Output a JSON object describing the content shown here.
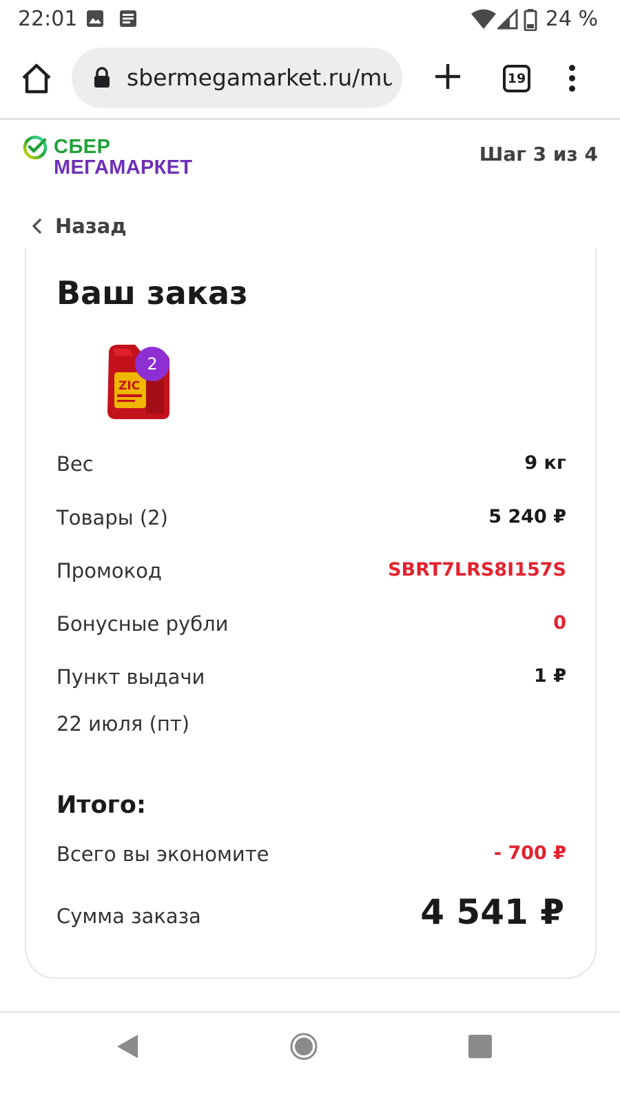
{
  "status_bar": {
    "time": "22:01",
    "battery_percent": "24 %",
    "icons": [
      "image-icon",
      "news-icon",
      "wifi-icon",
      "signal-icon",
      "battery-icon"
    ]
  },
  "browser": {
    "url": "sbermegamarket.ru/multi",
    "tab_count": "19"
  },
  "header": {
    "logo_line1": "СБЕР",
    "logo_line2": "МЕГАМАРКЕТ",
    "step": "Шаг 3 из 4"
  },
  "back_label": "Назад",
  "order": {
    "title": "Ваш заказ",
    "item_quantity": "2",
    "rows": [
      {
        "label": "Вес",
        "value": "9 кг"
      },
      {
        "label": "Товары (2)",
        "value": "5 240 ₽"
      },
      {
        "label": "Промокод",
        "value": "SBRT7LRS8I157S"
      },
      {
        "label": "Бонусные рубли",
        "value": "0"
      },
      {
        "label": "Пункт выдачи",
        "value": "1 ₽"
      }
    ],
    "delivery_date": "22 июля (пт)",
    "total_title": "Итого:",
    "savings_label": "Всего вы экономите",
    "savings_value": "- 700 ₽",
    "sum_label": "Сумма заказа",
    "sum_value": "4 541 ₽"
  },
  "colors": {
    "accent_red": "#e3232f",
    "badge_purple": "#8e2fd4",
    "brand_green": "#21a038",
    "brand_purple": "#6d2fb5"
  }
}
